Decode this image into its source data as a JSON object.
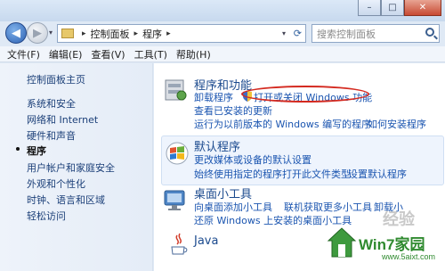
{
  "window": {
    "minimize_glyph": "–",
    "maximize_glyph": "□",
    "close_glyph": "✕"
  },
  "nav": {
    "back_glyph": "◀",
    "forward_glyph": "▶",
    "dropdown_glyph": "▾"
  },
  "address": {
    "separator": "▸",
    "crumbs": [
      "控制面板",
      "程序"
    ],
    "dropdown_glyph": "▾",
    "refresh_glyph": "⟳"
  },
  "search": {
    "placeholder": "搜索控制面板"
  },
  "menu": [
    "文件(F)",
    "编辑(E)",
    "查看(V)",
    "工具(T)",
    "帮助(H)"
  ],
  "sidebar": {
    "items": [
      {
        "label": "控制面板主页"
      },
      {
        "label": "系统和安全"
      },
      {
        "label": "网络和 Internet"
      },
      {
        "label": "硬件和声音"
      },
      {
        "label": "程序"
      },
      {
        "label": "用户帐户和家庭安全"
      },
      {
        "label": "外观和个性化"
      },
      {
        "label": "时钟、语言和区域"
      },
      {
        "label": "轻松访问"
      }
    ]
  },
  "categories": {
    "programs": {
      "title": "程序和功能",
      "links": [
        "卸载程序",
        "打开或关闭 Windows 功能",
        "查看已安装的更新",
        "运行为以前版本的 Windows 编写的程序",
        "如何安装程序"
      ]
    },
    "defaults": {
      "title": "默认程序",
      "links": [
        "更改媒体或设备的默认设置",
        "始终使用指定的程序打开此文件类型",
        "设置默认程序"
      ]
    },
    "gadgets": {
      "title": "桌面小工具",
      "links": [
        "向桌面添加小工具",
        "联机获取更多小工具",
        "卸载小",
        "还原 Windows 上安装的桌面小工具"
      ]
    },
    "java": {
      "title": "Java"
    }
  },
  "watermark": {
    "brand": "Win7家园",
    "url": "www.5aixt.com",
    "ghost_text": "经验"
  },
  "colors": {
    "link": "#1b55b0",
    "title": "#1b4a8e",
    "annotation_ring": "#d42a20",
    "watermark": "#2f8a2f"
  }
}
